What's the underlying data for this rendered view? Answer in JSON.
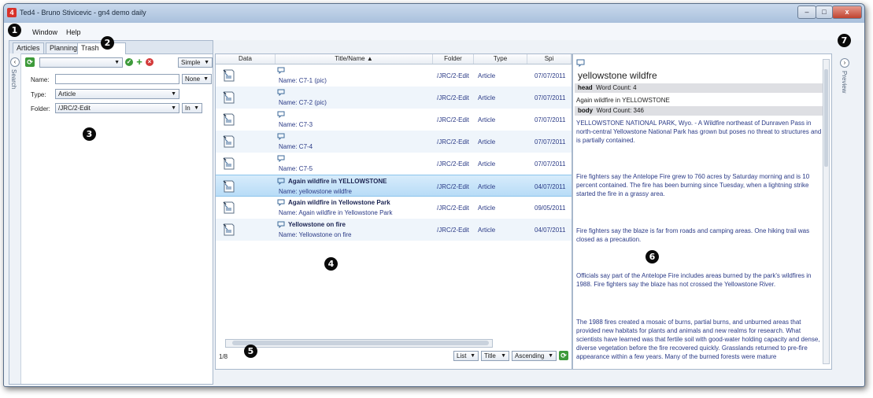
{
  "window": {
    "title": "Ted4 - Bruno Stivicevic - gn4 demo daily",
    "app_icon": "4",
    "minimize": "–",
    "maximize": "□",
    "close": "x"
  },
  "menu": {
    "items": [
      "Window",
      "Help"
    ]
  },
  "badges": [
    "1",
    "2",
    "3",
    "4",
    "5",
    "6",
    "7"
  ],
  "tabs": [
    "Articles",
    "Planning",
    "Trash"
  ],
  "search": {
    "strip_label": "Search",
    "mode": "Simple",
    "name_label": "Name:",
    "name_value": "",
    "name_option": "None",
    "type_label": "Type:",
    "type_value": "Article",
    "folder_label": "Folder:",
    "folder_value": "/JRC/2-Edit",
    "folder_option": "In"
  },
  "table": {
    "columns": [
      "Data",
      "Title/Name ▲",
      "Folder",
      "Type",
      "Spi"
    ],
    "rows": [
      {
        "title": "",
        "name": "Name:  C7-1 (pic)",
        "folder": "/JRC/2-Edit",
        "type": "Article",
        "date": "07/07/2011"
      },
      {
        "title": "",
        "name": "Name:  C7-2 (pic)",
        "folder": "/JRC/2-Edit",
        "type": "Article",
        "date": "07/07/2011"
      },
      {
        "title": "",
        "name": "Name:  C7-3",
        "folder": "/JRC/2-Edit",
        "type": "Article",
        "date": "07/07/2011"
      },
      {
        "title": "",
        "name": "Name:  C7-4",
        "folder": "/JRC/2-Edit",
        "type": "Article",
        "date": "07/07/2011"
      },
      {
        "title": "",
        "name": "Name:  C7-5",
        "folder": "/JRC/2-Edit",
        "type": "Article",
        "date": "07/07/2011"
      },
      {
        "title": "Again wildfire in YELLOWSTONE",
        "name": "Name:  yellowstone wildfre",
        "folder": "/JRC/2-Edit",
        "type": "Article",
        "date": "04/07/2011",
        "selected": true
      },
      {
        "title": "Again wildfire in Yellowstone Park",
        "name": "Name:  Again wildfire in Yellowstone Park",
        "folder": "/JRC/2-Edit",
        "type": "Article",
        "date": "09/05/2011"
      },
      {
        "title": "Yellowstone on fire",
        "name": "Name:  Yellowstone on fire",
        "folder": "/JRC/2-Edit",
        "type": "Article",
        "date": "04/07/2011"
      }
    ]
  },
  "footer": {
    "count": "1/8",
    "view": "List",
    "sort_field": "Title",
    "sort_order": "Ascending"
  },
  "preview": {
    "strip_label": "Preview",
    "heading": "yellowstone wildfre",
    "head_label": "head",
    "head_count": "Word Count: 4",
    "head_text": "Again wildfire in YELLOWSTONE",
    "body_label": "body",
    "body_count": "Word Count: 346",
    "paragraphs": [
      "YELLOWSTONE NATIONAL PARK, Wyo. - A Wildfire northeast of Dunraven Pass in north-central Yellowstone National Park has grown but poses no threat to structures and is partially contained.",
      "Fire fighters say the Antelope Fire grew to 760 acres by Saturday morning and is 10 percent contained. The fire has been burning since Tuesday, when a lightning strike started the fire in a grassy area.",
      "Fire fighters say the blaze is far from roads and camping areas. One hiking trail was closed as a precaution.",
      "Officials say part of the Antelope Fire includes areas burned by the park's wildfires in 1988. Fire fighters say the blaze has not crossed the Yellowstone River.",
      "The 1988 fires created a mosaic of burns, partial burns, and unburned areas that provided new habitats for plants and animals and new realms for research. What scientists have learned was that fertile soil with good-water holding capacity and dense, diverse vegetation before the fire recovered quickly. Grasslands returned to pre-fire appearance within a few years. Many of the burned forests were mature"
    ]
  },
  "colors": {
    "accent": "#8cc4ec",
    "link_text": "#2a3a86",
    "title_text": "#1b2452",
    "app_red": "#d8322a"
  }
}
